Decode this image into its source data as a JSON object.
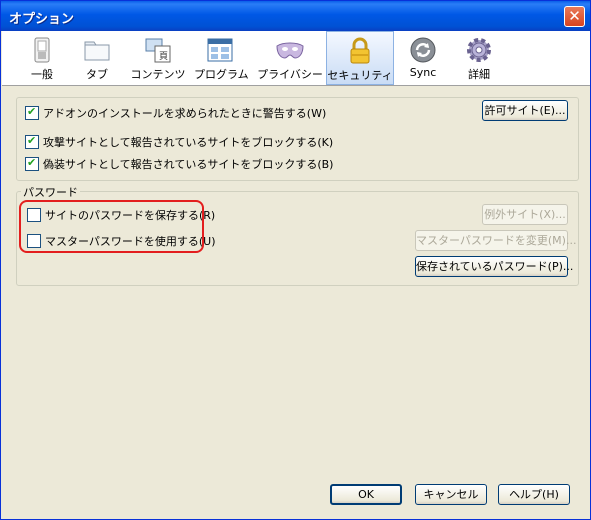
{
  "window": {
    "title": "オプション"
  },
  "tabs": [
    {
      "label": "一般",
      "icon": "switch-icon"
    },
    {
      "label": "タブ",
      "icon": "folder-tab-icon"
    },
    {
      "label": "コンテンツ",
      "icon": "content-icon"
    },
    {
      "label": "プログラム",
      "icon": "applications-icon"
    },
    {
      "label": "プライバシー",
      "icon": "mask-icon"
    },
    {
      "label": "セキュリティ",
      "icon": "padlock-icon",
      "selected": true
    },
    {
      "label": "Sync",
      "icon": "sync-icon"
    },
    {
      "label": "詳細",
      "icon": "gear-icon"
    }
  ],
  "security": {
    "warn_addon": {
      "label": "アドオンのインストールを求められたときに警告する(W)",
      "checked": true
    },
    "exceptions_button": "許可サイト(E)...",
    "block_attack": {
      "label": "攻撃サイトとして報告されているサイトをブロックする(K)",
      "checked": true
    },
    "block_forgery": {
      "label": "偽装サイトとして報告されているサイトをブロックする(B)",
      "checked": true
    }
  },
  "passwords": {
    "group_label": "パスワード",
    "remember": {
      "label": "サイトのパスワードを保存する(R)",
      "checked": false
    },
    "exceptions_button": "例外サイト(X)...",
    "master": {
      "label": "マスターパスワードを使用する(U)",
      "checked": false
    },
    "change_master_button": "マスターパスワードを変更(M)...",
    "saved_button": "保存されているパスワード(P)..."
  },
  "footer": {
    "ok": "OK",
    "cancel": "キャンセル",
    "help": "ヘルプ(H)"
  },
  "colors": {
    "highlight": "#e31e1e",
    "titlebar": "#0058e6"
  }
}
